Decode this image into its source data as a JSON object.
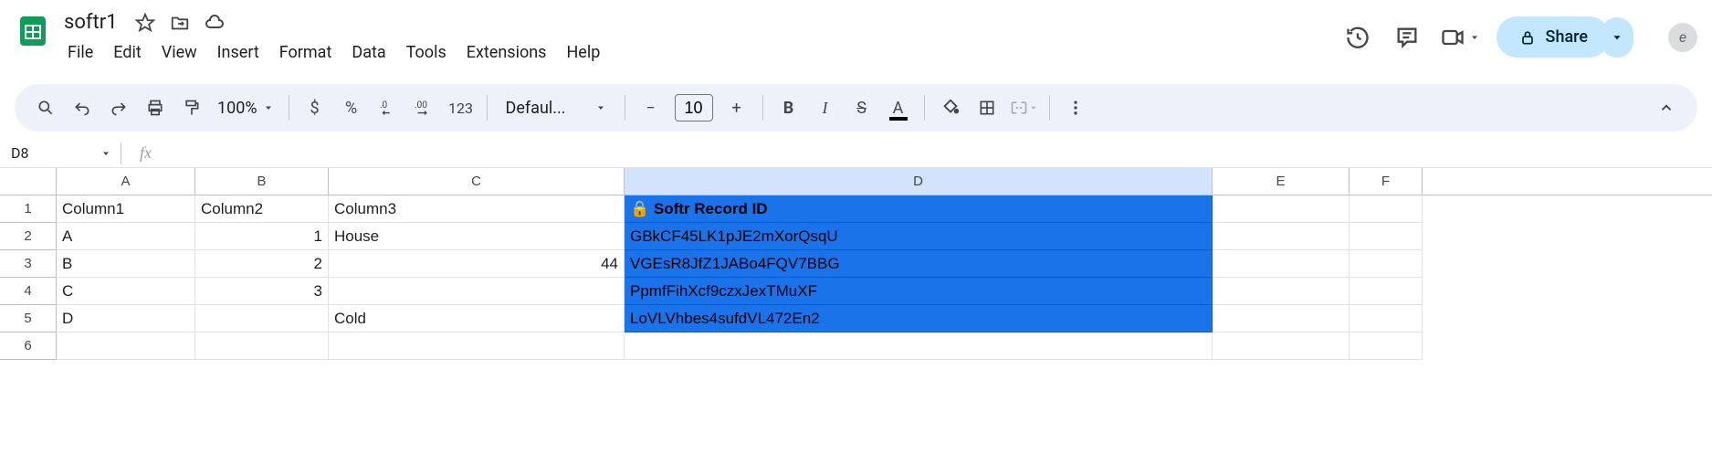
{
  "header": {
    "title": "softr1",
    "menus": [
      "File",
      "Edit",
      "View",
      "Insert",
      "Format",
      "Data",
      "Tools",
      "Extensions",
      "Help"
    ],
    "share_label": "Share",
    "avatar_letter": "e"
  },
  "toolbar": {
    "zoom": "100%",
    "number_format": "123",
    "font": "Defaul...",
    "font_size": "10"
  },
  "namebox": {
    "cell_ref": "D8",
    "formula": ""
  },
  "grid": {
    "columns": [
      "A",
      "B",
      "C",
      "D",
      "E",
      "F"
    ],
    "selected_column": "D",
    "row_count": 6,
    "rows": [
      {
        "A": "Column1",
        "B": "Column2",
        "C": "Column3",
        "D": "🔒 Softr Record ID",
        "D_bold": true
      },
      {
        "A": "A",
        "B": "1",
        "C": "House",
        "D": "GBkCF45LK1pJE2mXorQsqU"
      },
      {
        "A": "B",
        "B": "2",
        "C": "44",
        "C_right": true,
        "D": "VGEsR8JfZ1JABo4FQV7BBG"
      },
      {
        "A": "C",
        "B": "3",
        "C": "",
        "D": "PpmfFihXcf9czxJexTMuXF"
      },
      {
        "A": "D",
        "B": "",
        "C": "Cold",
        "D": "LoVLVhbes4sufdVL472En2"
      },
      {
        "A": "",
        "B": "",
        "C": "",
        "D": ""
      }
    ]
  }
}
